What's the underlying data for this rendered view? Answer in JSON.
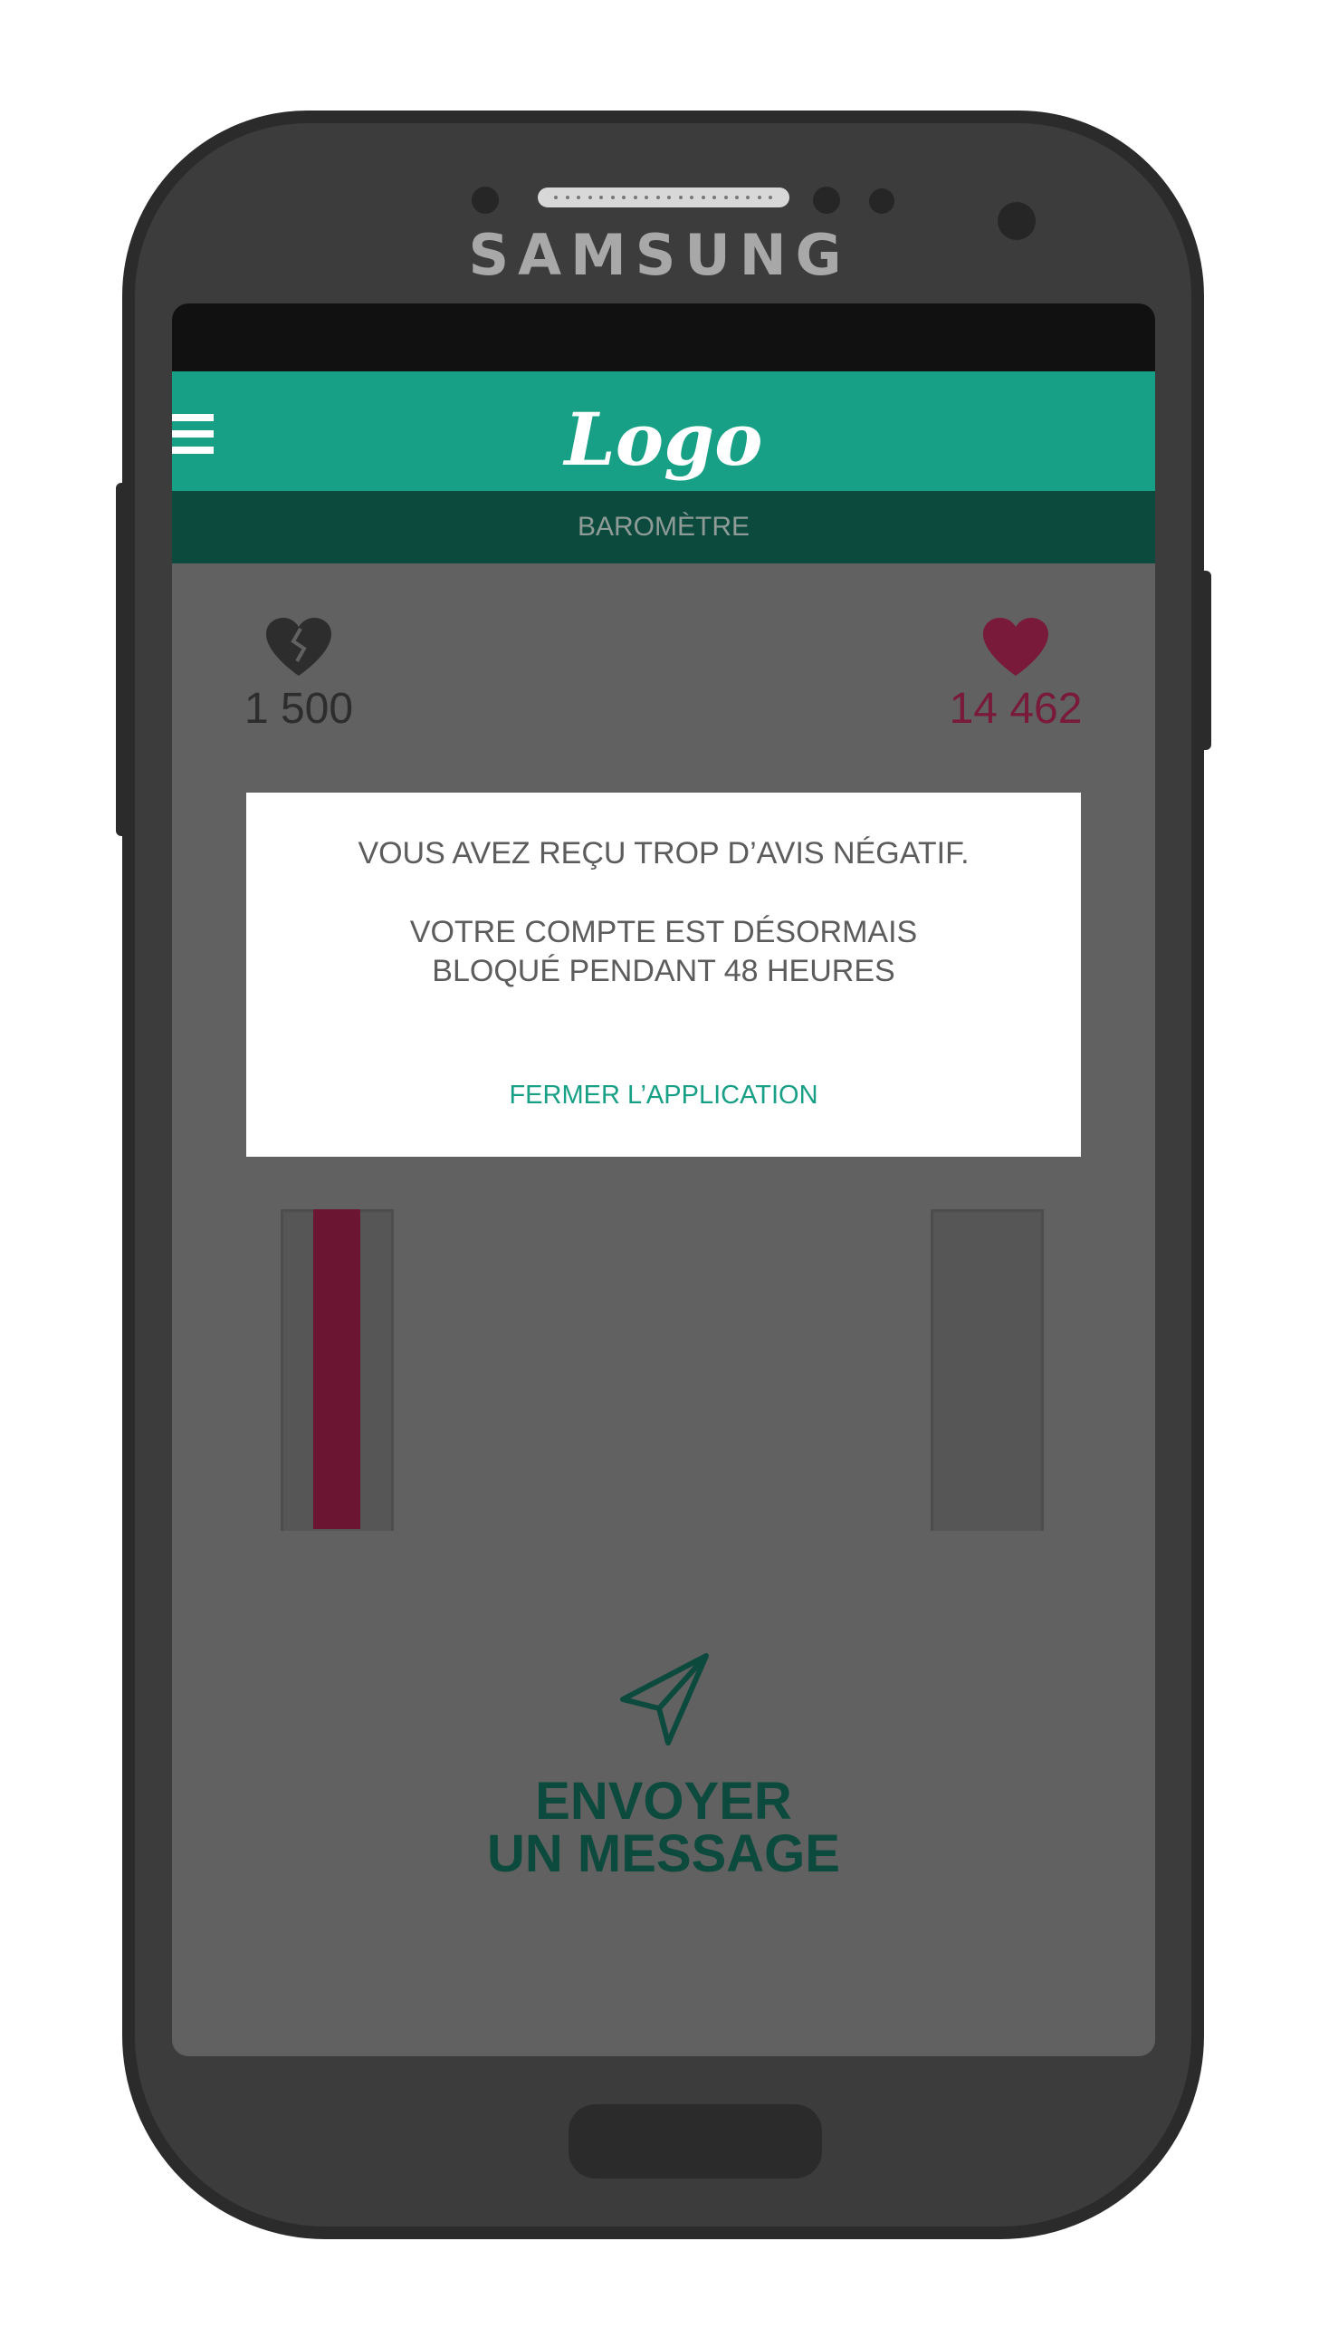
{
  "device": {
    "brand": "SAMSUNG"
  },
  "app": {
    "logo": "Logo",
    "section_title": "BAROMÈTRE"
  },
  "stats": {
    "negative_count": "1 500",
    "positive_count": "14 462"
  },
  "dialog": {
    "line1": "VOUS AVEZ REÇU TROP D’AVIS NÉGATIF.",
    "line2": "VOTRE COMPTE EST DÉSORMAIS",
    "line3": "BLOQUÉ PENDANT 48 HEURES",
    "action_label": "FERMER L’APPLICATION"
  },
  "send": {
    "line1": "ENVOYER",
    "line2": "UN MESSAGE"
  },
  "colors": {
    "app_bar": "#17a085",
    "sub_bar": "#0c4a3d",
    "screen_bg": "#616161",
    "negative": "#2d2d2d",
    "positive": "#7a1a3a",
    "accent": "#17a085",
    "send": "#0c4a3d"
  }
}
